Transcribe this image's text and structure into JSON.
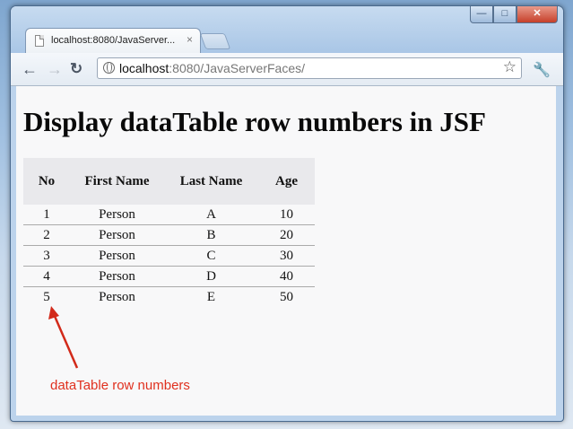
{
  "browser": {
    "tab_title": "localhost:8080/JavaServer...",
    "tab_close": "×",
    "url_host": "localhost",
    "url_path": ":8080/JavaServerFaces/",
    "window_buttons": {
      "minimize": "—",
      "maximize": "□",
      "close": "✕"
    },
    "icons": [
      "back-icon",
      "forward-icon",
      "reload-icon",
      "globe-icon",
      "star-icon",
      "wrench-icon",
      "page-icon"
    ]
  },
  "page": {
    "heading": "Display dataTable row numbers in JSF",
    "table": {
      "headers": [
        "No",
        "First Name",
        "Last Name",
        "Age"
      ],
      "rows": [
        [
          "1",
          "Person",
          "A",
          "10"
        ],
        [
          "2",
          "Person",
          "B",
          "20"
        ],
        [
          "3",
          "Person",
          "C",
          "30"
        ],
        [
          "4",
          "Person",
          "D",
          "40"
        ],
        [
          "5",
          "Person",
          "E",
          "50"
        ]
      ]
    },
    "annotation": "dataTable row numbers",
    "annotation_color": "#e0301e"
  }
}
